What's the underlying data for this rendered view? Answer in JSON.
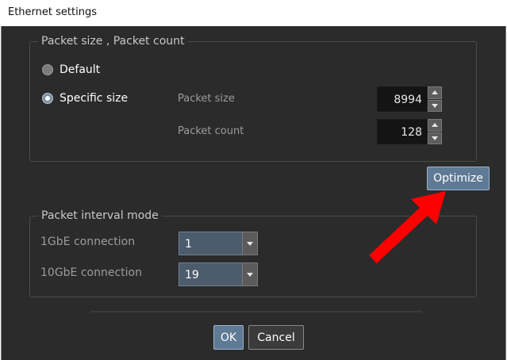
{
  "window": {
    "title": "Ethernet settings"
  },
  "packet_group": {
    "title": "Packet size , Packet count",
    "options": {
      "default_label": "Default",
      "specific_label": "Specific size"
    },
    "packet_size": {
      "label": "Packet size",
      "value": "8994"
    },
    "packet_count": {
      "label": "Packet count",
      "value": "128"
    }
  },
  "optimize_button": {
    "label": "Optimize"
  },
  "interval_group": {
    "title": "Packet interval mode",
    "one_gbe": {
      "label": "1GbE connection",
      "value": "1"
    },
    "ten_gbe": {
      "label": "10GbE connection",
      "value": "19"
    }
  },
  "footer": {
    "ok_label": "OK",
    "cancel_label": "Cancel"
  },
  "colors": {
    "dialog_background": "#2b2b2b",
    "arrow_annotation": "#ff0000",
    "selection_accent": "#5f7a95"
  },
  "icons": {
    "spin_up": "triangle-up",
    "spin_down": "triangle-down",
    "combo_dropdown": "chevron-down",
    "annotation": "red-arrow"
  }
}
